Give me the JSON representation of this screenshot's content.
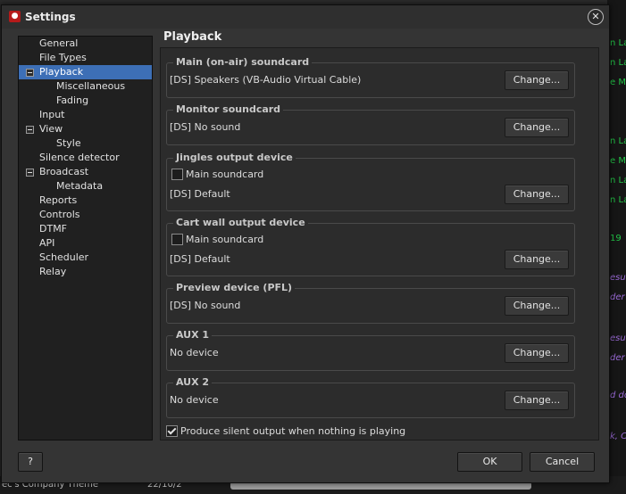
{
  "window": {
    "title": "Settings",
    "close_glyph": "✕"
  },
  "background": {
    "right_lines": [
      {
        "text": "n La",
        "style": "green"
      },
      {
        "text": "n La",
        "style": "green"
      },
      {
        "text": "e M",
        "style": "green"
      },
      {
        "text": "n La",
        "style": "green"
      },
      {
        "text": "e M",
        "style": "green"
      },
      {
        "text": "n La",
        "style": "green"
      },
      {
        "text": "n La",
        "style": "green"
      },
      {
        "text": "19",
        "style": "green"
      },
      {
        "text": "esu",
        "style": "violet"
      },
      {
        "text": "der ",
        "style": "violet"
      },
      {
        "text": "esu",
        "style": "violet"
      },
      {
        "text": "der ",
        "style": "violet"
      },
      {
        "text": "d do",
        "style": "violet"
      },
      {
        "text": "k, C",
        "style": "violet"
      }
    ],
    "bottom_left": "ec's Company Theme",
    "bottom_mid": "22/10/2"
  },
  "nav": {
    "items": [
      {
        "label": "General",
        "indent": 0
      },
      {
        "label": "File Types",
        "indent": 0
      },
      {
        "label": "Playback",
        "indent": 0,
        "expander": true,
        "selected": true
      },
      {
        "label": "Miscellaneous",
        "indent": 1
      },
      {
        "label": "Fading",
        "indent": 1
      },
      {
        "label": "Input",
        "indent": 0
      },
      {
        "label": "View",
        "indent": 0,
        "expander": true
      },
      {
        "label": "Style",
        "indent": 1
      },
      {
        "label": "Silence detector",
        "indent": 0
      },
      {
        "label": "Broadcast",
        "indent": 0,
        "expander": true
      },
      {
        "label": "Metadata",
        "indent": 1
      },
      {
        "label": "Reports",
        "indent": 0
      },
      {
        "label": "Controls",
        "indent": 0
      },
      {
        "label": "DTMF",
        "indent": 0
      },
      {
        "label": "API",
        "indent": 0
      },
      {
        "label": "Scheduler",
        "indent": 0
      },
      {
        "label": "Relay",
        "indent": 0
      }
    ]
  },
  "playback": {
    "title": "Playback",
    "groups": [
      {
        "legend": "Main (on-air) soundcard",
        "device": "[DS] Speakers (VB-Audio Virtual Cable)",
        "button": "Change..."
      },
      {
        "legend": "Monitor soundcard",
        "device": "[DS] No sound",
        "button": "Change..."
      },
      {
        "legend": "Jingles output device",
        "checkbox_label": "Main soundcard",
        "checked": false,
        "device": "[DS] Default",
        "button": "Change..."
      },
      {
        "legend": "Cart wall output device",
        "checkbox_label": "Main soundcard",
        "checked": false,
        "device": "[DS] Default",
        "button": "Change..."
      },
      {
        "legend": "Preview device (PFL)",
        "device": "[DS] No sound",
        "button": "Change..."
      },
      {
        "legend": "AUX 1",
        "device": "No device",
        "button": "Change..."
      },
      {
        "legend": "AUX 2",
        "device": "No device",
        "button": "Change..."
      }
    ],
    "silent_output": {
      "label": "Produce silent output when nothing is playing",
      "checked": true
    }
  },
  "footer": {
    "help": "?",
    "ok": "OK",
    "cancel": "Cancel"
  }
}
